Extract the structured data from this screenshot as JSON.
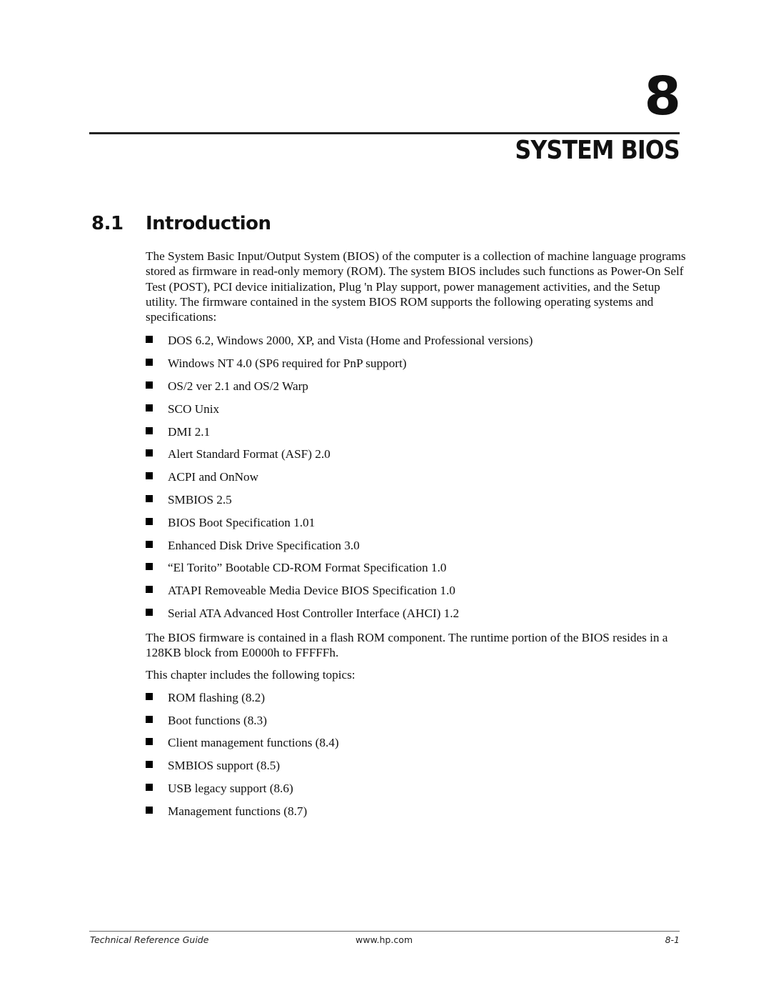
{
  "chapter": {
    "number": "8",
    "title": "SYSTEM BIOS"
  },
  "section": {
    "number": "8.1",
    "title": "Introduction"
  },
  "intro_paragraph": "The System Basic Input/Output System (BIOS) of the computer is a collection of machine language programs stored as firmware in read-only memory (ROM). The system BIOS includes such functions as Power-On Self Test (POST), PCI device initialization, Plug 'n Play support, power management activities, and the Setup utility. The firmware contained in the system BIOS ROM supports the following operating systems and specifications:",
  "supported_list": [
    "DOS 6.2, Windows 2000, XP, and Vista (Home and Professional versions)",
    "Windows NT 4.0 (SP6 required for PnP support)",
    "OS/2 ver 2.1 and OS/2 Warp",
    "SCO Unix",
    "DMI 2.1",
    "Alert Standard Format (ASF) 2.0",
    "ACPI and OnNow",
    "SMBIOS 2.5",
    "BIOS Boot Specification 1.01",
    "Enhanced Disk Drive Specification 3.0",
    "“El Torito” Bootable CD-ROM Format Specification 1.0",
    "ATAPI Removeable Media Device BIOS Specification 1.0",
    "Serial ATA Advanced Host Controller Interface (AHCI) 1.2"
  ],
  "firmware_paragraph": "The BIOS firmware is contained in a flash ROM component. The runtime portion of the BIOS resides in a 128KB block from E0000h to FFFFFh.",
  "topics_intro": "This chapter includes the following topics:",
  "topics_list": [
    "ROM flashing  (8.2)",
    "Boot functions (8.3)",
    "Client management functions (8.4)",
    "SMBIOS support (8.5)",
    "USB legacy support (8.6)",
    "Management functions (8.7)"
  ],
  "footer": {
    "left": "Technical Reference Guide",
    "center": "www.hp.com",
    "right": "8-1"
  }
}
